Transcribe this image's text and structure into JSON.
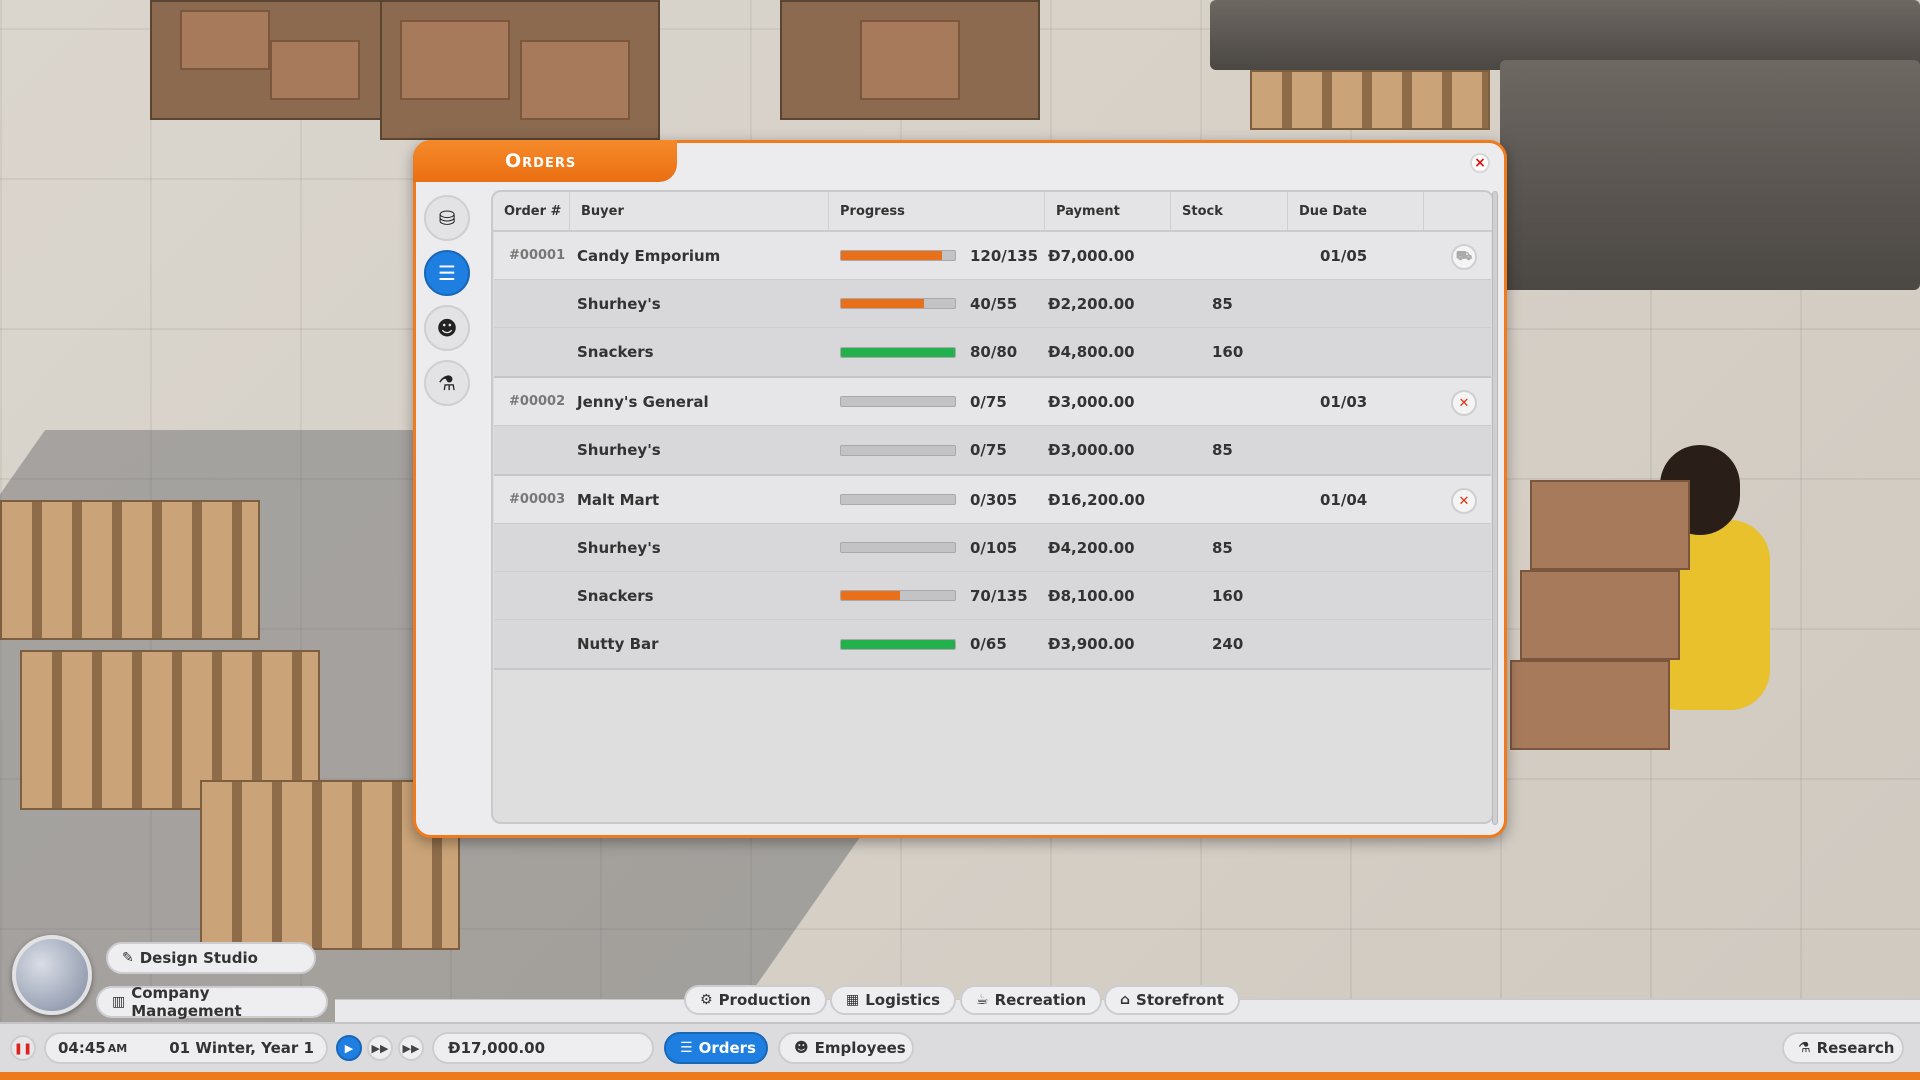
{
  "window": {
    "title": "Orders",
    "close_glyph": "×",
    "sidebar": [
      {
        "icon": "coins-icon",
        "glyph": "⛁",
        "active": false
      },
      {
        "icon": "clipboard-icon",
        "glyph": "☰",
        "active": true
      },
      {
        "icon": "people-icon",
        "glyph": "☻",
        "active": false
      },
      {
        "icon": "flask-icon",
        "glyph": "⚗",
        "active": false
      }
    ]
  },
  "table": {
    "headers": {
      "order": "Order #",
      "buyer": "Buyer",
      "progress": "Progress",
      "payment": "Payment",
      "stock": "Stock",
      "due": "Due Date"
    },
    "orders": [
      {
        "id": "#00001",
        "buyer": "Candy Emporium",
        "progress": 0.89,
        "qty": "120/135",
        "payment": "Đ7,000.00",
        "due": "01/05",
        "action": "truck-icon",
        "items": [
          {
            "name": "Shurhey's",
            "progress": 0.73,
            "color": "orange",
            "qty": "40/55",
            "payment": "Đ2,200.00",
            "stock": "85"
          },
          {
            "name": "Snackers",
            "progress": 1.0,
            "color": "green",
            "qty": "80/80",
            "payment": "Đ4,800.00",
            "stock": "160"
          }
        ]
      },
      {
        "id": "#00002",
        "buyer": "Jenny's General",
        "progress": 0.0,
        "qty": "0/75",
        "payment": "Đ3,000.00",
        "due": "01/03",
        "action": "cancel-icon",
        "items": [
          {
            "name": "Shurhey's",
            "progress": 0.0,
            "color": "orange",
            "qty": "0/75",
            "payment": "Đ3,000.00",
            "stock": "85"
          }
        ]
      },
      {
        "id": "#00003",
        "buyer": "Malt Mart",
        "progress": 0.0,
        "qty": "0/305",
        "payment": "Đ16,200.00",
        "due": "01/04",
        "action": "cancel-icon",
        "items": [
          {
            "name": "Shurhey's",
            "progress": 0.0,
            "color": "orange",
            "qty": "0/105",
            "payment": "Đ4,200.00",
            "stock": "85"
          },
          {
            "name": "Snackers",
            "progress": 0.52,
            "color": "orange",
            "qty": "70/135",
            "payment": "Đ8,100.00",
            "stock": "160"
          },
          {
            "name": "Nutty Bar",
            "progress": 1.0,
            "color": "green",
            "qty": "0/65",
            "payment": "Đ3,900.00",
            "stock": "240"
          }
        ]
      }
    ]
  },
  "hud": {
    "design_studio": "Design Studio",
    "company_management": "Company Management",
    "tabs": [
      "Production",
      "Logistics",
      "Recreation",
      "Storefront"
    ],
    "time": "04:45",
    "ampm": "AM",
    "date": "01 Winter, Year 1",
    "money": "Đ17,000.00",
    "orders": "Orders",
    "employees": "Employees",
    "research": "Research"
  },
  "colors": {
    "accent": "#ee7a1e",
    "active_blue": "#1f7fe0",
    "progress_orange": "#e8701a",
    "progress_green": "#22b14c",
    "cancel_red": "#d31111"
  }
}
